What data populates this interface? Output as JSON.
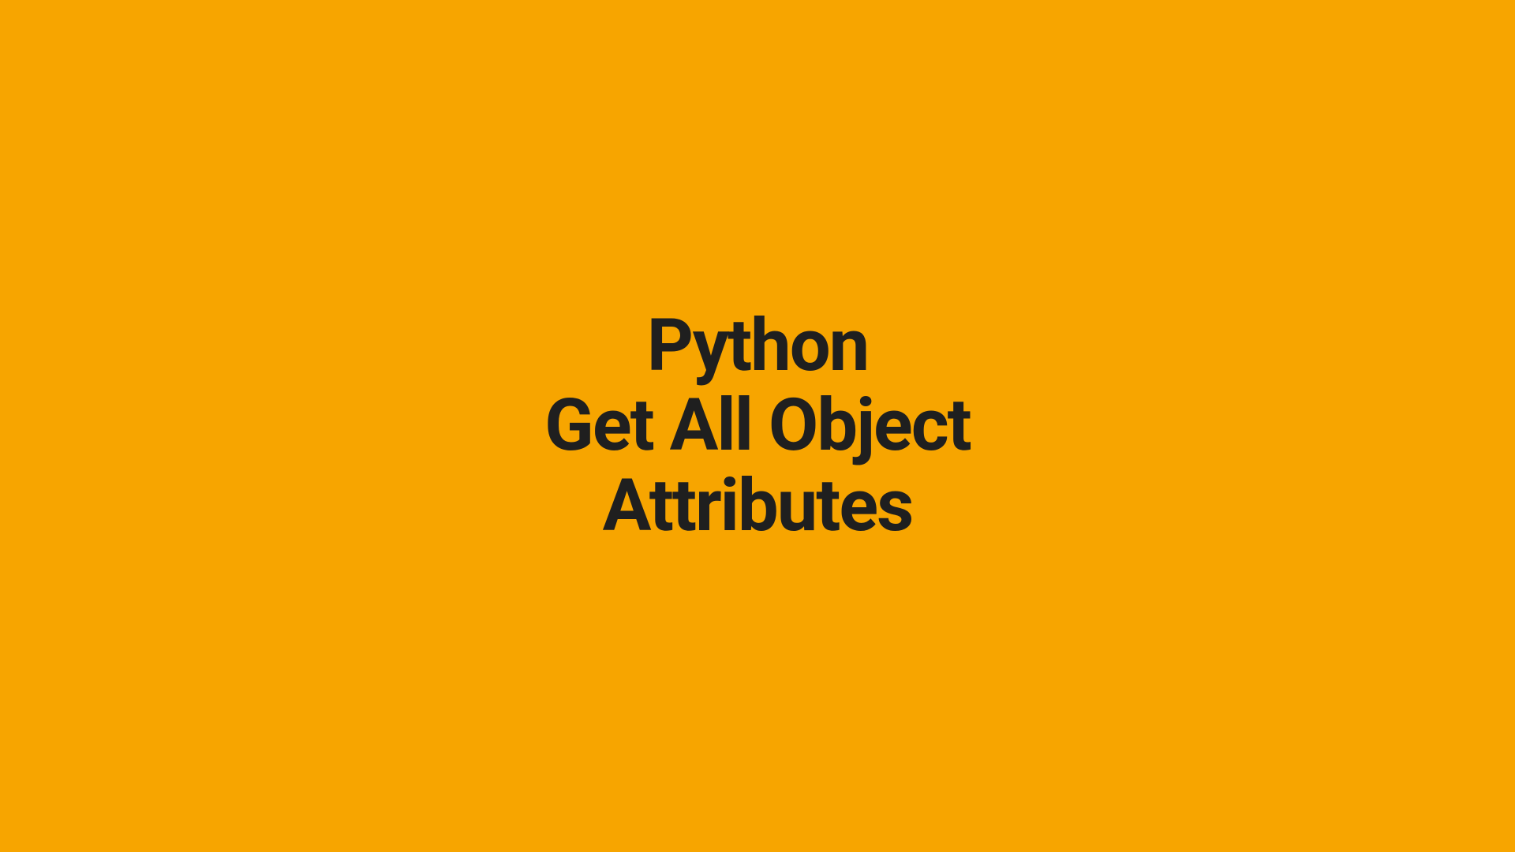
{
  "title": {
    "line1": "Python",
    "line2": "Get All Object",
    "line3": "Attributes"
  },
  "background_color": "#f7a500",
  "text_color": "#1f1f1f"
}
